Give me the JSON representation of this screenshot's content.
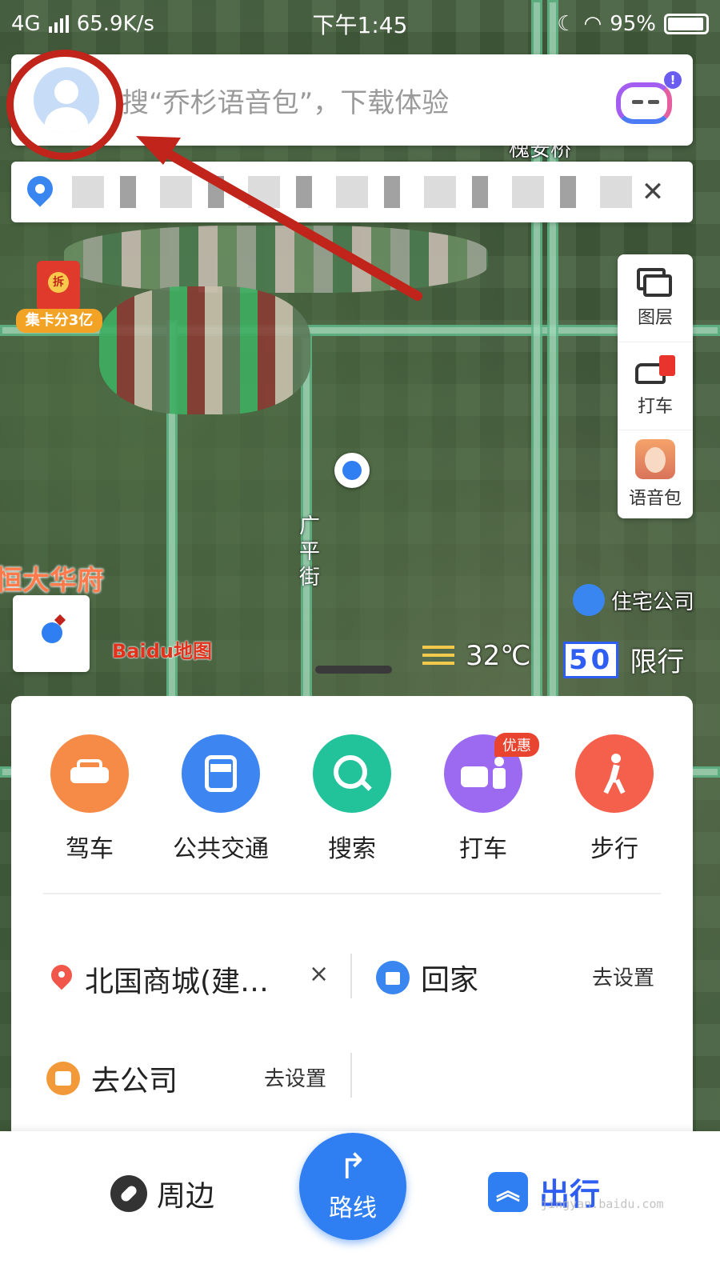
{
  "status_bar": {
    "network": "4G",
    "speed": "65.9K/s",
    "time": "下午1:45",
    "battery": "95%"
  },
  "search": {
    "placeholder": "搜“乔杉语音包”，下载体验",
    "notification_badge": "!"
  },
  "map": {
    "labels": {
      "bridge": "槐安桥",
      "estate": "恒大华府",
      "street": "广平街",
      "residential": "住宅公司"
    },
    "promo_text": "集卡分3亿",
    "promo_seal": "拆",
    "logo": "Baidu地图",
    "temperature": "32℃",
    "traffic_limit_number": "50",
    "traffic_limit_label": "限行"
  },
  "side_tools": [
    {
      "label": "图层",
      "icon": "layers-icon"
    },
    {
      "label": "打车",
      "icon": "taxi-icon"
    },
    {
      "label": "语音包",
      "icon": "voice-pack-icon"
    }
  ],
  "modes": [
    {
      "label": "驾车",
      "icon": "car-icon",
      "color": "#f68b48"
    },
    {
      "label": "公共交通",
      "icon": "bus-icon",
      "color": "#3d86f2"
    },
    {
      "label": "搜索",
      "icon": "search-icon",
      "color": "#22c39a"
    },
    {
      "label": "打车",
      "icon": "taxi-icon",
      "color": "#9b6af0",
      "badge": "优惠"
    },
    {
      "label": "步行",
      "icon": "walk-icon",
      "color": "#f4604b"
    }
  ],
  "shortcuts": {
    "recent": {
      "name": "北国商城(建…",
      "close": "×"
    },
    "home": {
      "name": "回家",
      "action": "去设置"
    },
    "work": {
      "name": "去公司",
      "action": "去设置"
    }
  },
  "bottom_nav": {
    "nearby": "周边",
    "route": "路线",
    "trip": "出行"
  },
  "watermark": "jingyan.baidu.com",
  "colors": {
    "accent_blue": "#2f7ff2",
    "annotation_red": "#c0241a"
  }
}
